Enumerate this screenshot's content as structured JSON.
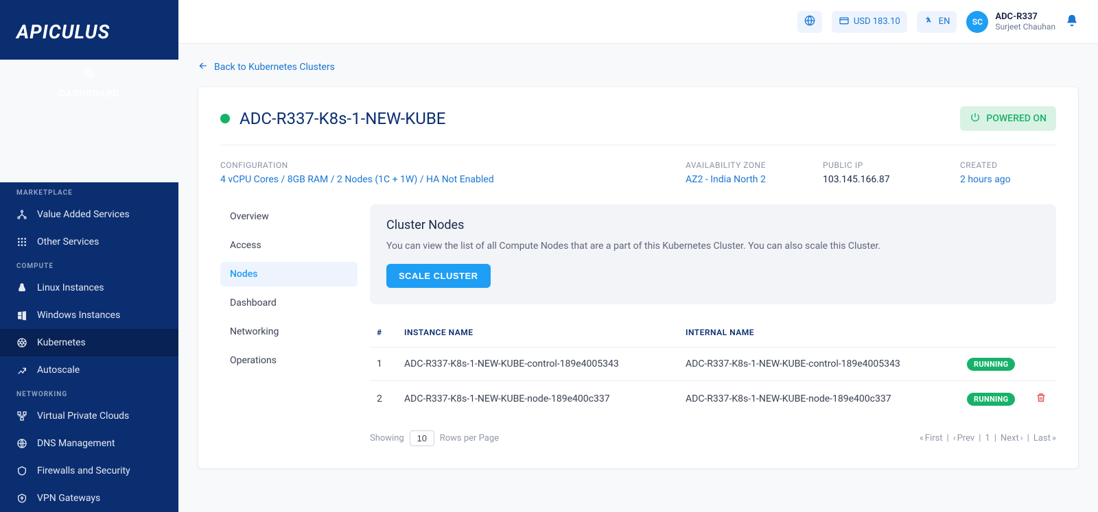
{
  "logo": "APICULUS",
  "sidebar": {
    "dashboard": "DASHBOARD",
    "sections": [
      {
        "title": "MARKETPLACE",
        "items": [
          {
            "icon": "hierarchy-icon",
            "label": "Value Added Services"
          },
          {
            "icon": "grid-icon",
            "label": "Other Services"
          }
        ]
      },
      {
        "title": "COMPUTE",
        "items": [
          {
            "icon": "linux-icon",
            "label": "Linux Instances"
          },
          {
            "icon": "windows-icon",
            "label": "Windows Instances"
          },
          {
            "icon": "kubernetes-icon",
            "label": "Kubernetes",
            "active": true
          },
          {
            "icon": "autoscale-icon",
            "label": "Autoscale"
          }
        ]
      },
      {
        "title": "NETWORKING",
        "items": [
          {
            "icon": "vpc-icon",
            "label": "Virtual Private Clouds"
          },
          {
            "icon": "dns-icon",
            "label": "DNS Management"
          },
          {
            "icon": "firewall-icon",
            "label": "Firewalls and Security"
          },
          {
            "icon": "vpn-icon",
            "label": "VPN Gateways"
          }
        ]
      }
    ]
  },
  "topbar": {
    "balance": "USD 183.10",
    "language": "EN",
    "avatar_initials": "SC",
    "user_code": "ADC-R337",
    "user_name": "Surjeet Chauhan"
  },
  "back_link": "Back to Kubernetes Clusters",
  "cluster": {
    "name": "ADC-R337-K8s-1-NEW-KUBE",
    "power_state": "POWERED ON",
    "meta": {
      "config_label": "CONFIGURATION",
      "config_value": "4 vCPU Cores / 8GB RAM / 2 Nodes (1C + 1W) / HA Not Enabled",
      "az_label": "AVAILABILITY ZONE",
      "az_value": "AZ2 - India North 2",
      "ip_label": "PUBLIC IP",
      "ip_value": "103.145.166.87",
      "created_label": "CREATED",
      "created_value": "2 hours ago"
    }
  },
  "tabs": [
    "Overview",
    "Access",
    "Nodes",
    "Dashboard",
    "Networking",
    "Operations"
  ],
  "active_tab": "Nodes",
  "panel": {
    "title": "Cluster Nodes",
    "desc": "You can view the list of all Compute Nodes that are a part of this Kubernetes Cluster. You can also scale this Cluster.",
    "action": "SCALE CLUSTER"
  },
  "table": {
    "headers": {
      "idx": "#",
      "instance": "INSTANCE NAME",
      "internal": "INTERNAL NAME"
    },
    "rows": [
      {
        "idx": "1",
        "instance": "ADC-R337-K8s-1-NEW-KUBE-control-189e4005343",
        "internal": "ADC-R337-K8s-1-NEW-KUBE-control-189e4005343",
        "status": "RUNNING",
        "deletable": false
      },
      {
        "idx": "2",
        "instance": "ADC-R337-K8s-1-NEW-KUBE-node-189e400c337",
        "internal": "ADC-R337-K8s-1-NEW-KUBE-node-189e400c337",
        "status": "RUNNING",
        "deletable": true
      }
    ]
  },
  "pager": {
    "showing": "Showing",
    "rows_per": "Rows per Page",
    "rows_value": "10",
    "first": "First",
    "prev": "Prev",
    "page": "1",
    "next": "Next",
    "last": "Last"
  }
}
